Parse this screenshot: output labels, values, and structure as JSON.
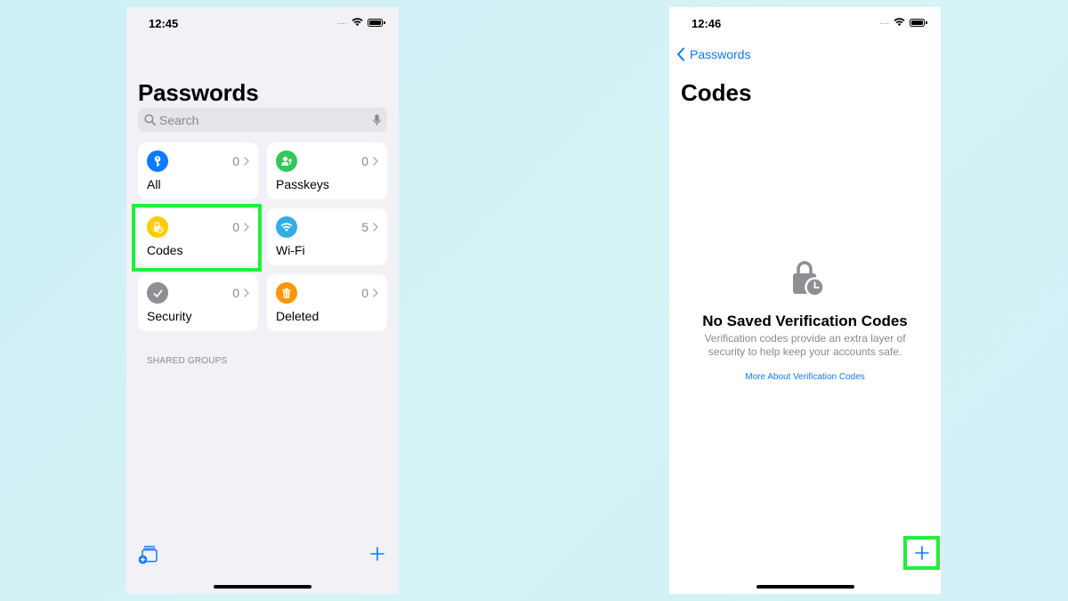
{
  "left_screen": {
    "status_time": "12:45",
    "title": "Passwords",
    "search": {
      "placeholder": "Search"
    },
    "tiles": [
      {
        "label": "All",
        "count": "0",
        "icon": "key-icon",
        "color": "#0a7aff"
      },
      {
        "label": "Passkeys",
        "count": "0",
        "icon": "passkey-person-icon",
        "color": "#34c759"
      },
      {
        "label": "Codes",
        "count": "0",
        "icon": "lock-clock-icon",
        "color": "#ffcc00",
        "highlighted": true
      },
      {
        "label": "Wi-Fi",
        "count": "5",
        "icon": "wifi-icon",
        "color": "#32ade6"
      },
      {
        "label": "Security",
        "count": "0",
        "icon": "checkmark-icon",
        "color": "#8e8e93"
      },
      {
        "label": "Deleted",
        "count": "0",
        "icon": "trash-icon",
        "color": "#ff9500"
      }
    ],
    "section_header": "SHARED GROUPS",
    "toolbar": {
      "new_group_icon": "new-group-icon",
      "add_icon": "plus-icon"
    }
  },
  "right_screen": {
    "status_time": "12:46",
    "back_label": "Passwords",
    "title": "Codes",
    "empty_state": {
      "icon": "lock-clock-icon",
      "title": "No Saved Verification Codes",
      "description": "Verification codes provide an extra layer of security to help keep your accounts safe.",
      "link": "More About Verification Codes"
    },
    "toolbar": {
      "add_icon": "plus-icon",
      "highlighted": true
    }
  },
  "colors": {
    "accent": "#0a7aff",
    "highlight": "#1df13a",
    "list_background": "#f1f1f6"
  }
}
